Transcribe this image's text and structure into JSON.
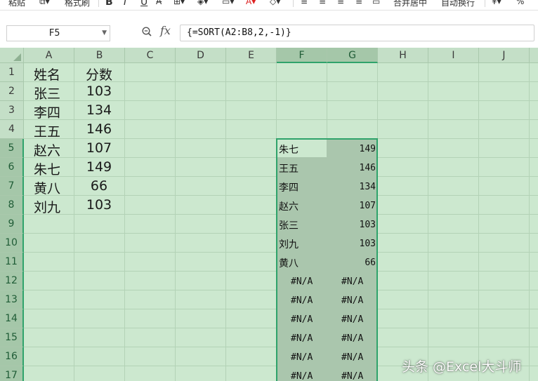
{
  "ribbon": {
    "paste": "粘贴",
    "format_painter": "格式刷",
    "bold": "B",
    "italic": "I",
    "underline": "U",
    "merge_center": "合并居中",
    "wrap_text": "自动换行",
    "percent": "%"
  },
  "formula_bar": {
    "cell_ref": "F5",
    "fx_label": "fx",
    "formula": "{=SORT(A2:B8,2,-1)}"
  },
  "columns": [
    "A",
    "B",
    "C",
    "D",
    "E",
    "F",
    "G",
    "H",
    "I",
    "J"
  ],
  "rows": [
    "1",
    "2",
    "3",
    "4",
    "5",
    "6",
    "7",
    "8",
    "9",
    "10",
    "11",
    "12",
    "13",
    "14",
    "15",
    "16",
    "17"
  ],
  "source_table": {
    "header_name": "姓名",
    "header_score": "分数",
    "rows": [
      {
        "name": "张三",
        "score": "103"
      },
      {
        "name": "李四",
        "score": "134"
      },
      {
        "name": "王五",
        "score": "146"
      },
      {
        "name": "赵六",
        "score": "107"
      },
      {
        "name": "朱七",
        "score": "149"
      },
      {
        "name": "黄八",
        "score": "66"
      },
      {
        "name": "刘九",
        "score": "103"
      }
    ]
  },
  "sorted_result": {
    "rows": [
      {
        "name": "朱七",
        "score": "149"
      },
      {
        "name": "王五",
        "score": "146"
      },
      {
        "name": "李四",
        "score": "134"
      },
      {
        "name": "赵六",
        "score": "107"
      },
      {
        "name": "张三",
        "score": "103"
      },
      {
        "name": "刘九",
        "score": "103"
      },
      {
        "name": "黄八",
        "score": "66"
      }
    ],
    "error_value": "#N/A"
  },
  "watermark": "头条 @Excel大斗师",
  "colors": {
    "grid_background": "#cce8cf",
    "selection_fill": "#aac6ad",
    "selection_border": "#2fa36b"
  }
}
